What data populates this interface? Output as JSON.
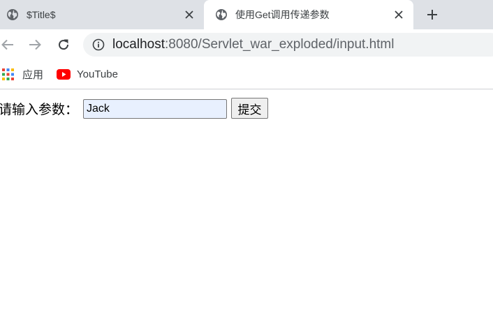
{
  "tabs": [
    {
      "title": "$Title$",
      "active": false,
      "icon": "globe-icon"
    },
    {
      "title": "使用Get调用传递参数",
      "active": true,
      "icon": "globe-icon"
    }
  ],
  "toolbar": {
    "back_icon": "back-arrow-icon",
    "forward_icon": "forward-arrow-icon",
    "reload_icon": "reload-icon",
    "url_host": "localhost",
    "url_path": ":8080/Servlet_war_exploded/input.html"
  },
  "bookmarks": [
    {
      "label": "应用",
      "icon": "apps-grid-icon"
    },
    {
      "label": "YouTube",
      "icon": "youtube-icon"
    }
  ],
  "form": {
    "label": "请输入参数：",
    "input_value": "Jack",
    "submit_label": "提交"
  },
  "colors": {
    "tabstrip_bg": "#dee1e6",
    "omnibox_bg": "#f1f3f4",
    "autofill_bg": "#e8f0fe",
    "youtube_red": "#ff0000"
  }
}
